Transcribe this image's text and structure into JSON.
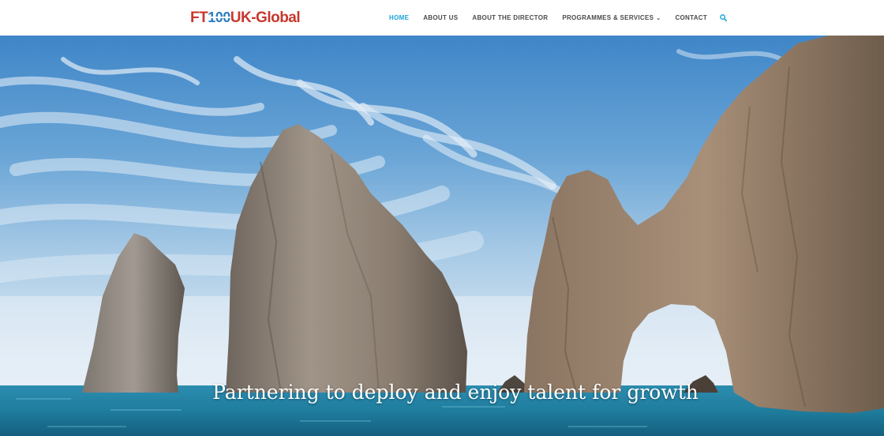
{
  "brand": {
    "logo_ft": "FT",
    "logo_num": "100",
    "logo_uk": "UK-Global"
  },
  "nav": {
    "items": [
      {
        "label": "HOME",
        "active": true
      },
      {
        "label": "ABOUT US",
        "active": false
      },
      {
        "label": "ABOUT THE DIRECTOR",
        "active": false
      },
      {
        "label": "PROGRAMMES & SERVICES",
        "active": false,
        "dropdown": true
      },
      {
        "label": "CONTACT",
        "active": false
      }
    ],
    "search_icon": "search-icon",
    "dropdown_icon": "chevron-down-icon"
  },
  "hero": {
    "tagline": "Partnering to deploy and enjoy talent for growth",
    "image": "sea-rock-arches-scene"
  },
  "colors": {
    "accent": "#1ba3d8",
    "nav_text": "#4a4a4a",
    "logo_red": "#c8372d",
    "logo_blue": "#2b7cc1"
  }
}
